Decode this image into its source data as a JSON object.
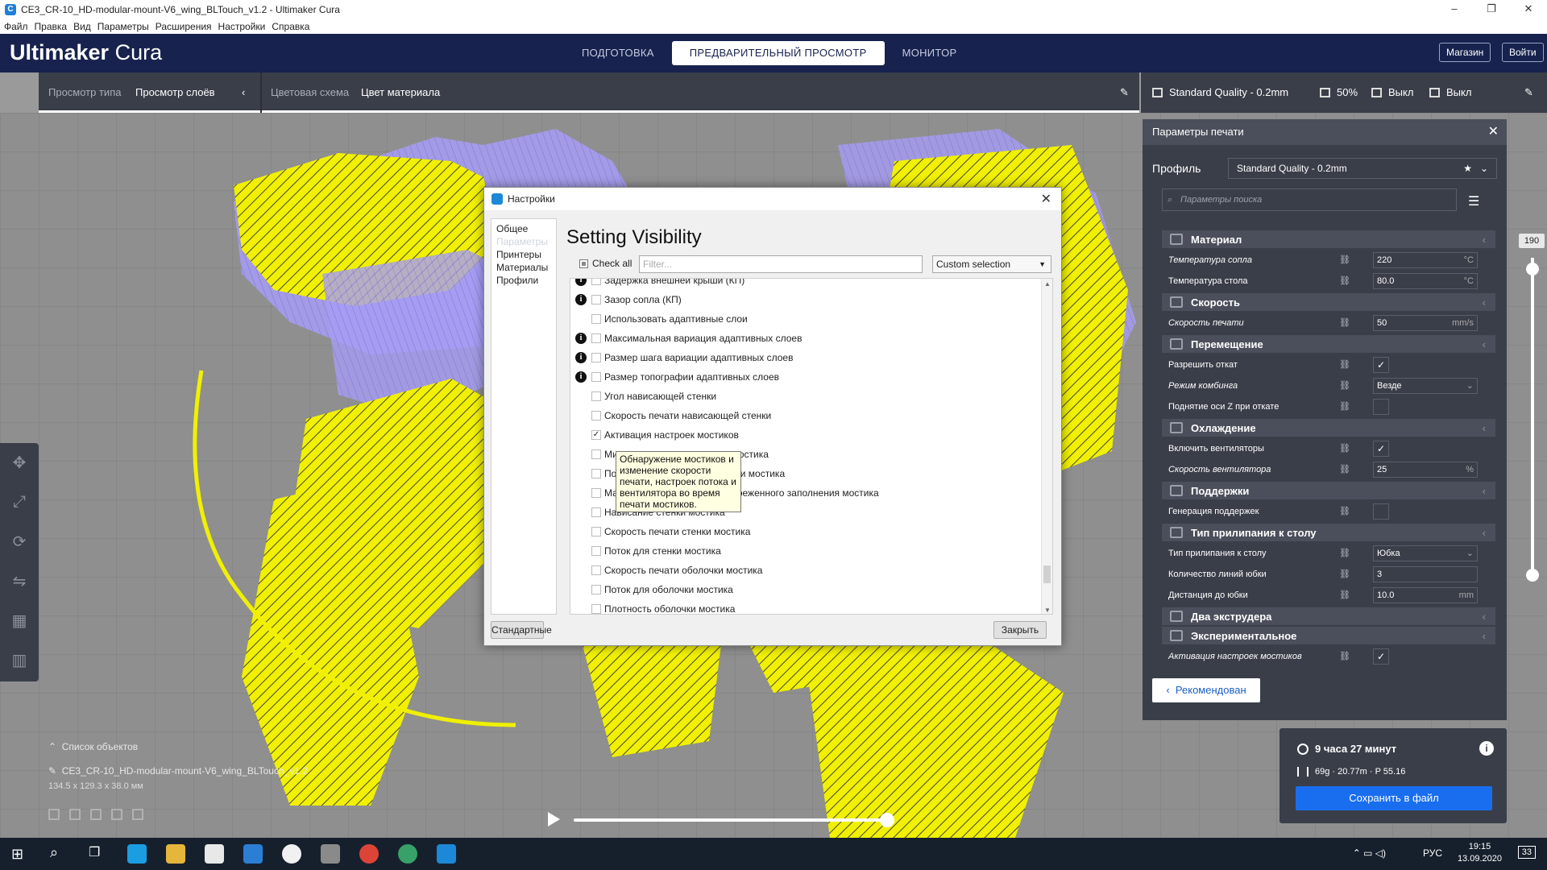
{
  "window": {
    "title": "CE3_CR-10_HD-modular-mount-V6_wing_BLTouch_v1.2 - Ultimaker Cura",
    "menu": [
      "Файл",
      "Правка",
      "Вид",
      "Параметры",
      "Расширения",
      "Настройки",
      "Справка"
    ]
  },
  "header": {
    "logo_bold": "Ultimaker",
    "logo_light": " Cura",
    "tabs": [
      "ПОДГОТОВКА",
      "ПРЕДВАРИТЕЛЬНЫЙ ПРОСМОТР",
      "МОНИТОР"
    ],
    "active_tab": 1,
    "store": "Магазин",
    "login": "Войти"
  },
  "viewbar": {
    "view_type_label": "Просмотр типа",
    "view_type_value": "Просмотр слоёв",
    "scheme_label": "Цветовая схема",
    "scheme_value": "Цвет материала"
  },
  "psbar": {
    "profile": "Standard Quality - 0.2mm",
    "infill": "50%",
    "support": "Выкл",
    "adhesion": "Выкл"
  },
  "panel": {
    "title": "Параметры печати",
    "profile_label": "Профиль",
    "profile_value": "Standard Quality - 0.2mm",
    "search_placeholder": "Параметры поиска",
    "recommended": "Рекомендован",
    "rows": [
      {
        "type": "cat",
        "name": "Материал"
      },
      {
        "type": "val",
        "name": "Температура сопла",
        "italic": true,
        "value": "220",
        "unit": "°C"
      },
      {
        "type": "val",
        "name": "Температура стола",
        "italic": false,
        "value": "80.0",
        "unit": "°C"
      },
      {
        "type": "cat",
        "name": "Скорость"
      },
      {
        "type": "val",
        "name": "Скорость печати",
        "italic": true,
        "value": "50",
        "unit": "mm/s"
      },
      {
        "type": "cat",
        "name": "Перемещение"
      },
      {
        "type": "chk",
        "name": "Разрешить откат",
        "italic": false,
        "checked": true
      },
      {
        "type": "val",
        "name": "Режим комбинга",
        "italic": true,
        "value": "Везде",
        "unit": "⌄"
      },
      {
        "type": "chk",
        "name": "Поднятие оси Z при откате",
        "italic": false,
        "checked": false
      },
      {
        "type": "cat",
        "name": "Охлаждение"
      },
      {
        "type": "chk",
        "name": "Включить вентиляторы",
        "italic": false,
        "checked": true
      },
      {
        "type": "val",
        "name": "Скорость вентилятора",
        "italic": true,
        "value": "25",
        "unit": "%"
      },
      {
        "type": "cat",
        "name": "Поддержки"
      },
      {
        "type": "chk",
        "name": "Генерация поддержек",
        "italic": false,
        "checked": false
      },
      {
        "type": "cat",
        "name": "Тип прилипания к столу"
      },
      {
        "type": "val",
        "name": "Тип прилипания к столу",
        "italic": false,
        "value": "Юбка",
        "unit": "⌄"
      },
      {
        "type": "val",
        "name": "Количество линий юбки",
        "italic": false,
        "value": "3",
        "unit": ""
      },
      {
        "type": "val",
        "name": "Дистанция до юбки",
        "italic": false,
        "value": "10.0",
        "unit": "mm"
      },
      {
        "type": "cat",
        "name": "Два экструдера"
      },
      {
        "type": "cat",
        "name": "Экспериментальное"
      },
      {
        "type": "chk",
        "name": "Активация настроек мостиков",
        "italic": true,
        "checked": true
      }
    ]
  },
  "action": {
    "time": "9 часа 27 минут",
    "material": "69g · 20.77m · P 55.16",
    "save": "Сохранить в файл"
  },
  "objects": {
    "list_label": "Список объектов",
    "file": "CE3_CR-10_HD-modular-mount-V6_wing_BLTouch_v1.2",
    "dims": "134.5 x 129.3 x 38.0 мм"
  },
  "layer_slider_value": "190",
  "dialog": {
    "title": "Настройки",
    "nav": [
      "Общее",
      "Параметры",
      "Принтеры",
      "Материалы",
      "Профили"
    ],
    "heading": "Setting Visibility",
    "check_all": "Check all",
    "filter_placeholder": "Filter...",
    "selection": "Custom selection",
    "items": [
      {
        "label": "Задержка внешней крыши (КП)",
        "info": true,
        "checked": false
      },
      {
        "label": "Зазор сопла (КП)",
        "info": true,
        "checked": false
      },
      {
        "label": "Использовать адаптивные слои",
        "info": false,
        "checked": false
      },
      {
        "label": "Максимальная вариация адаптивных слоев",
        "info": true,
        "checked": false
      },
      {
        "label": "Размер шага вариации адаптивных слоев",
        "info": true,
        "checked": false
      },
      {
        "label": "Размер топографии адаптивных слоев",
        "info": true,
        "checked": false
      },
      {
        "label": "Угол нависающей стенки",
        "info": false,
        "checked": false
      },
      {
        "label": "Скорость печати нависающей стенки",
        "info": false,
        "checked": false
      },
      {
        "label": "Активация настроек мостиков",
        "info": false,
        "checked": true
      },
      {
        "label": "Минимальная длина стенки мостика",
        "info": false,
        "checked": false
      },
      {
        "label": "Порог поддержки для оболочки мостика",
        "info": false,
        "checked": false
      },
      {
        "label": "Максимальная плотность разреженного заполнения мостика",
        "info": false,
        "checked": false
      },
      {
        "label": "Нависание стенки мостика",
        "info": false,
        "checked": false
      },
      {
        "label": "Скорость печати стенки мостика",
        "info": false,
        "checked": false
      },
      {
        "label": "Поток для стенки мостика",
        "info": false,
        "checked": false
      },
      {
        "label": "Скорость печати оболочки мостика",
        "info": false,
        "checked": false
      },
      {
        "label": "Поток для оболочки мостика",
        "info": false,
        "checked": false
      },
      {
        "label": "Плотность оболочки мостика",
        "info": false,
        "checked": false
      }
    ],
    "tooltip": "Обнаружение мостиков и изменение скорости печати, настроек потока и вентилятора во время печати мостиков.",
    "defaults_btn": "Стандартные",
    "close_btn": "Закрыть"
  },
  "taskbar": {
    "lang": "РУС",
    "time": "19:15",
    "date": "13.09.2020",
    "notif": "33"
  },
  "colors": {
    "header": "#17224e",
    "panel": "#3a3e49",
    "accent": "#196ef0",
    "model": "#f0f000",
    "travel": "#9b8cf2"
  }
}
